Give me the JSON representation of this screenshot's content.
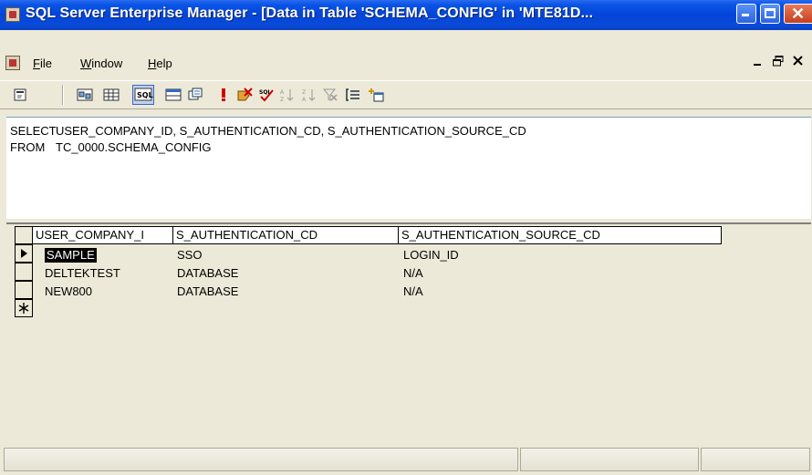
{
  "window": {
    "title": "SQL Server Enterprise Manager - [Data in Table 'SCHEMA_CONFIG' in 'MTE81D..."
  },
  "menu": {
    "items": [
      {
        "label": "File"
      },
      {
        "label": "Window"
      },
      {
        "label": "Help"
      }
    ]
  },
  "toolbar": {
    "icons": [
      "properties-icon",
      "show-diagram-pane-icon",
      "show-grid-pane-icon",
      "show-sql-pane-icon",
      "show-results-pane-icon",
      "change-query-type-icon",
      "run-icon",
      "cancel-query-icon",
      "verify-sql-icon",
      "sort-ascending-icon",
      "sort-descending-icon",
      "remove-filter-icon",
      "group-by-icon",
      "add-table-icon"
    ],
    "sql_pressed": true
  },
  "sql": {
    "select_kw": "SELECT",
    "select_cols": "USER_COMPANY_ID, S_AUTHENTICATION_CD, S_AUTHENTICATION_SOURCE_CD",
    "from_kw": "FROM",
    "from_table": "TC_0000.SCHEMA_CONFIG"
  },
  "grid": {
    "columns": [
      "USER_COMPANY_ID",
      "S_AUTHENTICATION_CD",
      "S_AUTHENTICATION_SOURCE_CD"
    ],
    "column_display": [
      "USER_COMPANY_I",
      "S_AUTHENTICATION_CD",
      "S_AUTHENTICATION_SOURCE_CD"
    ],
    "rows": [
      [
        "SAMPLE",
        "SSO",
        "LOGIN_ID"
      ],
      [
        "DELTEKTEST",
        "DATABASE",
        "N/A"
      ],
      [
        "NEW800",
        "DATABASE",
        "N/A"
      ]
    ],
    "current_row_marker": "▶",
    "new_row_marker": "✱"
  },
  "colors": {
    "title_bar": "#0a55e6",
    "chrome": "#ece9d8",
    "selection": "#000000"
  }
}
